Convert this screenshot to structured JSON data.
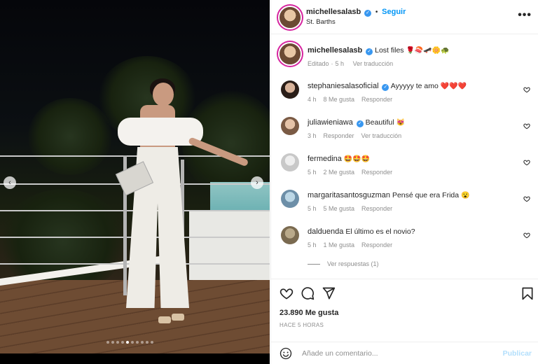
{
  "post": {
    "author": "michellesalasb",
    "follow_label": "Seguir",
    "location": "St. Barths",
    "more_label": "•••",
    "carousel": {
      "prev_label": "‹",
      "next_label": "›",
      "slide_count": 10,
      "active_slide": 5
    }
  },
  "caption": {
    "author": "michellesalasb",
    "text": "Lost files",
    "emojis": "🌹🍣🛹🌼🐢",
    "edited_label": "Editado",
    "time": "5 h",
    "translate_label": "Ver traducción"
  },
  "comments": [
    {
      "user": "stephaniesalasoficial",
      "verified": true,
      "text": "Ayyyyy te amo",
      "emojis": "❤️❤️❤️",
      "time": "4 h",
      "likes": "8 Me gusta",
      "reply": "Responder",
      "translate": ""
    },
    {
      "user": "juliawieniawa",
      "verified": true,
      "text": "Beautiful",
      "emojis": "😻",
      "time": "3 h",
      "likes": "",
      "reply": "Responder",
      "translate": "Ver traducción"
    },
    {
      "user": "fermedina",
      "verified": false,
      "text": "",
      "emojis": "🤩🤩🤩",
      "time": "5 h",
      "likes": "2 Me gusta",
      "reply": "Responder",
      "translate": ""
    },
    {
      "user": "margaritasantosguzman",
      "verified": false,
      "text": "Pensé que era Frida",
      "emojis": "😮",
      "time": "5 h",
      "likes": "5 Me gusta",
      "reply": "Responder",
      "translate": ""
    },
    {
      "user": "dalduenda",
      "verified": false,
      "text": "El último es el novio?",
      "emojis": "",
      "time": "5 h",
      "likes": "1 Me gusta",
      "reply": "Responder",
      "translate": ""
    }
  ],
  "view_replies": "Ver respuestas (1)",
  "likes_count": "23.890 Me gusta",
  "posted_ago": "HACE 5 HORAS",
  "composer": {
    "placeholder": "Añade un comentario...",
    "publish_label": "Publicar"
  },
  "icons": [
    "heart-icon",
    "comment-icon",
    "share-icon",
    "bookmark-icon",
    "emoji-icon",
    "verified-icon",
    "more-icon"
  ],
  "colors": {
    "link_blue": "#0095f6",
    "verified_blue": "#3897f0",
    "muted": "#8e8e8e",
    "publish_disabled": "#b2dffc"
  }
}
